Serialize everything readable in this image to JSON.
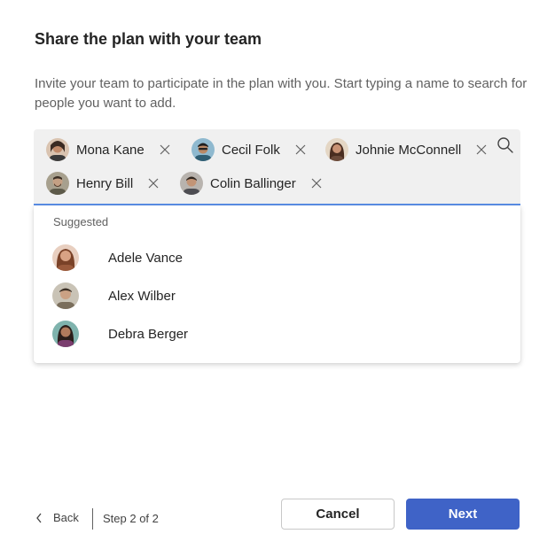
{
  "dialog": {
    "title": "Share the plan with your team",
    "description": "Invite your team to participate in the plan with you. Start typing a name to search for people you want to add."
  },
  "selected_people": [
    {
      "name": "Mona Kane",
      "avatar_color": "#4a3b35"
    },
    {
      "name": "Cecil Folk",
      "avatar_color": "#2f5d73"
    },
    {
      "name": "Johnie McConnell",
      "avatar_color": "#6b4a3a"
    },
    {
      "name": "Henry Bill",
      "avatar_color": "#5d5a4a"
    },
    {
      "name": "Colin Ballinger",
      "avatar_color": "#4d4d52"
    }
  ],
  "search": {
    "icon": "search-icon"
  },
  "suggestions": {
    "label": "Suggested",
    "items": [
      {
        "name": "Adele Vance",
        "avatar_color": "#9a5a3c"
      },
      {
        "name": "Alex Wilber",
        "avatar_color": "#7a6e5c"
      },
      {
        "name": "Debra Berger",
        "avatar_color": "#3f6e6a"
      }
    ]
  },
  "footer": {
    "back_label": "Back",
    "step_label": "Step 2 of 2",
    "cancel_label": "Cancel",
    "next_label": "Next"
  },
  "colors": {
    "primary": "#3f63c7",
    "picker_background": "#f0f0f0",
    "focus_underline": "#5b8fe8"
  }
}
